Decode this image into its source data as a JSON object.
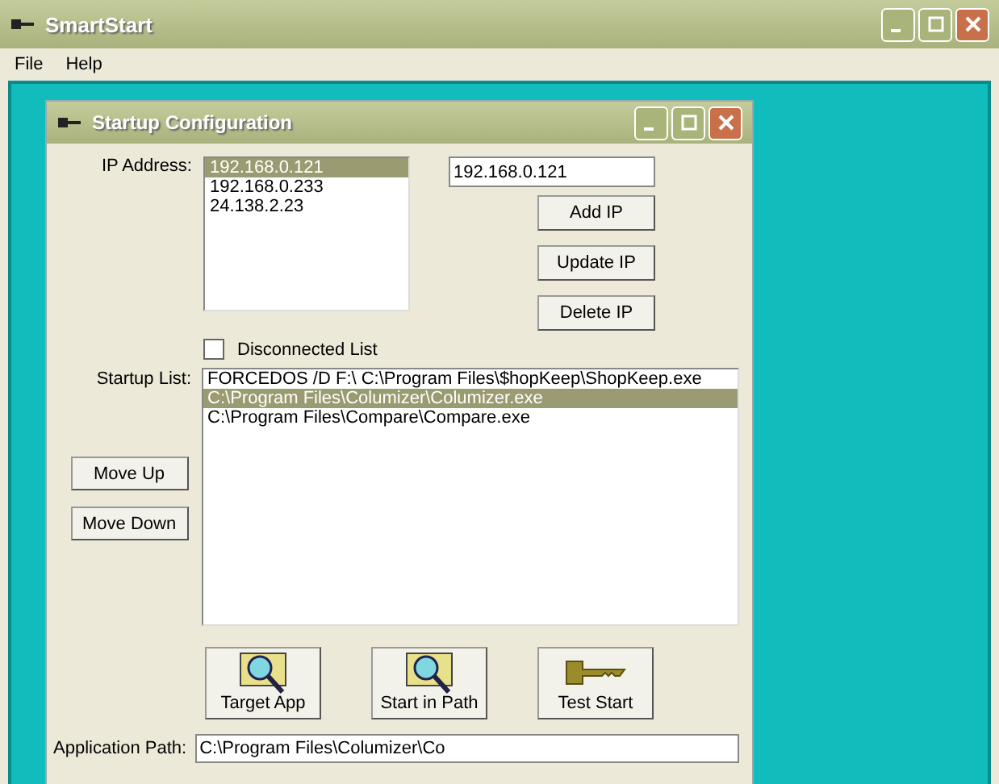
{
  "window": {
    "title": "SmartStart"
  },
  "menu": [
    "File",
    "Help"
  ],
  "dialog": {
    "title": "Startup Configuration",
    "ip_label": "IP Address:",
    "ip_list": [
      {
        "text": "192.168.0.121",
        "selected": true
      },
      {
        "text": "192.168.0.233",
        "selected": false
      },
      {
        "text": "24.138.2.23",
        "selected": false
      }
    ],
    "ip_field": {
      "value": "192.168.0.121"
    },
    "ip_buttons": [
      "Add IP",
      "Update IP",
      "Delete IP"
    ],
    "disconnected": {
      "label": "Disconnected List",
      "checked": false
    },
    "startup_label": "Startup List:",
    "startup_list": [
      {
        "text": "FORCEDOS /D F:\\ C:\\Program Files\\$hopKeep\\ShopKeep.exe",
        "selected": false
      },
      {
        "text": "C:\\Program Files\\Columizer\\Columizer.exe",
        "selected": true
      },
      {
        "text": "C:\\Program Files\\Compare\\Compare.exe",
        "selected": false
      }
    ],
    "move_buttons": [
      "Move Up",
      "Move Down"
    ],
    "tool_buttons": [
      {
        "label": "Target App",
        "kind": "search"
      },
      {
        "label": "Start in Path",
        "kind": "search"
      },
      {
        "label": "Test Start",
        "kind": "key"
      }
    ],
    "path_label": "Application Path:",
    "path_field": {
      "value": "C:\\Program Files\\Columizer\\Co"
    }
  }
}
